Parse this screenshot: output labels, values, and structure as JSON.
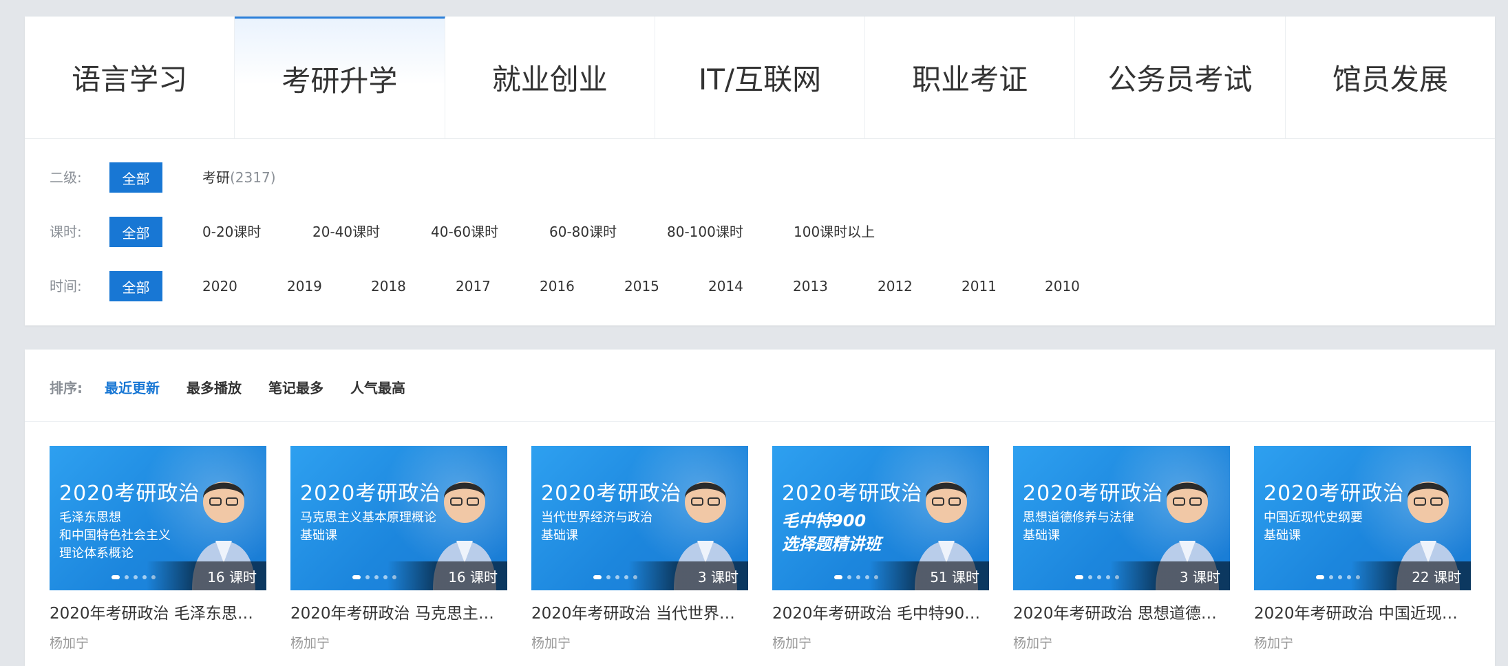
{
  "tabs": [
    {
      "label": "语言学习",
      "active": false
    },
    {
      "label": "考研升学",
      "active": true
    },
    {
      "label": "就业创业",
      "active": false
    },
    {
      "label": "IT/互联网",
      "active": false
    },
    {
      "label": "职业考证",
      "active": false
    },
    {
      "label": "公务员考试",
      "active": false
    },
    {
      "label": "馆员发展",
      "active": false
    }
  ],
  "filters": {
    "level2": {
      "label": "二级:",
      "all": "全部",
      "options": [
        {
          "text": "考研",
          "count": "(2317)"
        }
      ]
    },
    "hours": {
      "label": "课时:",
      "all": "全部",
      "options": [
        "0-20课时",
        "20-40课时",
        "40-60课时",
        "60-80课时",
        "80-100课时",
        "100课时以上"
      ]
    },
    "time": {
      "label": "时间:",
      "all": "全部",
      "options": [
        "2020",
        "2019",
        "2018",
        "2017",
        "2016",
        "2015",
        "2014",
        "2013",
        "2012",
        "2011",
        "2010"
      ]
    }
  },
  "sort": {
    "label": "排序:",
    "options": [
      "最近更新",
      "最多播放",
      "笔记最多",
      "人气最高"
    ],
    "active": "最近更新"
  },
  "courses": [
    {
      "thumb_title": "2020考研政治",
      "thumb_sub": "毛泽东思想\n和中国特色社会主义\n理论体系概论",
      "lessons": "16 课时",
      "title": "2020年考研政治 毛泽东思…",
      "teacher": "杨加宁"
    },
    {
      "thumb_title": "2020考研政治",
      "thumb_sub": "马克思主义基本原理概论\n基础课",
      "lessons": "16 课时",
      "title": "2020年考研政治 马克思主…",
      "teacher": "杨加宁"
    },
    {
      "thumb_title": "2020考研政治",
      "thumb_sub": "当代世界经济与政治\n基础课",
      "lessons": "3 课时",
      "title": "2020年考研政治 当代世界…",
      "teacher": "杨加宁"
    },
    {
      "thumb_title": "2020考研政治",
      "thumb_sub": "毛中特900\n选择题精讲班",
      "lessons": "51 课时",
      "title": "2020年考研政治 毛中特90…",
      "teacher": "杨加宁"
    },
    {
      "thumb_title": "2020考研政治",
      "thumb_sub": "思想道德修养与法律\n基础课",
      "lessons": "3 课时",
      "title": "2020年考研政治 思想道德…",
      "teacher": "杨加宁"
    },
    {
      "thumb_title": "2020考研政治",
      "thumb_sub": "中国近现代史纲要\n基础课",
      "lessons": "22 课时",
      "title": "2020年考研政治 中国近现…",
      "teacher": "杨加宁"
    }
  ],
  "colors": {
    "accent": "#1877d4",
    "thumb_bg": "#1c86dd"
  }
}
